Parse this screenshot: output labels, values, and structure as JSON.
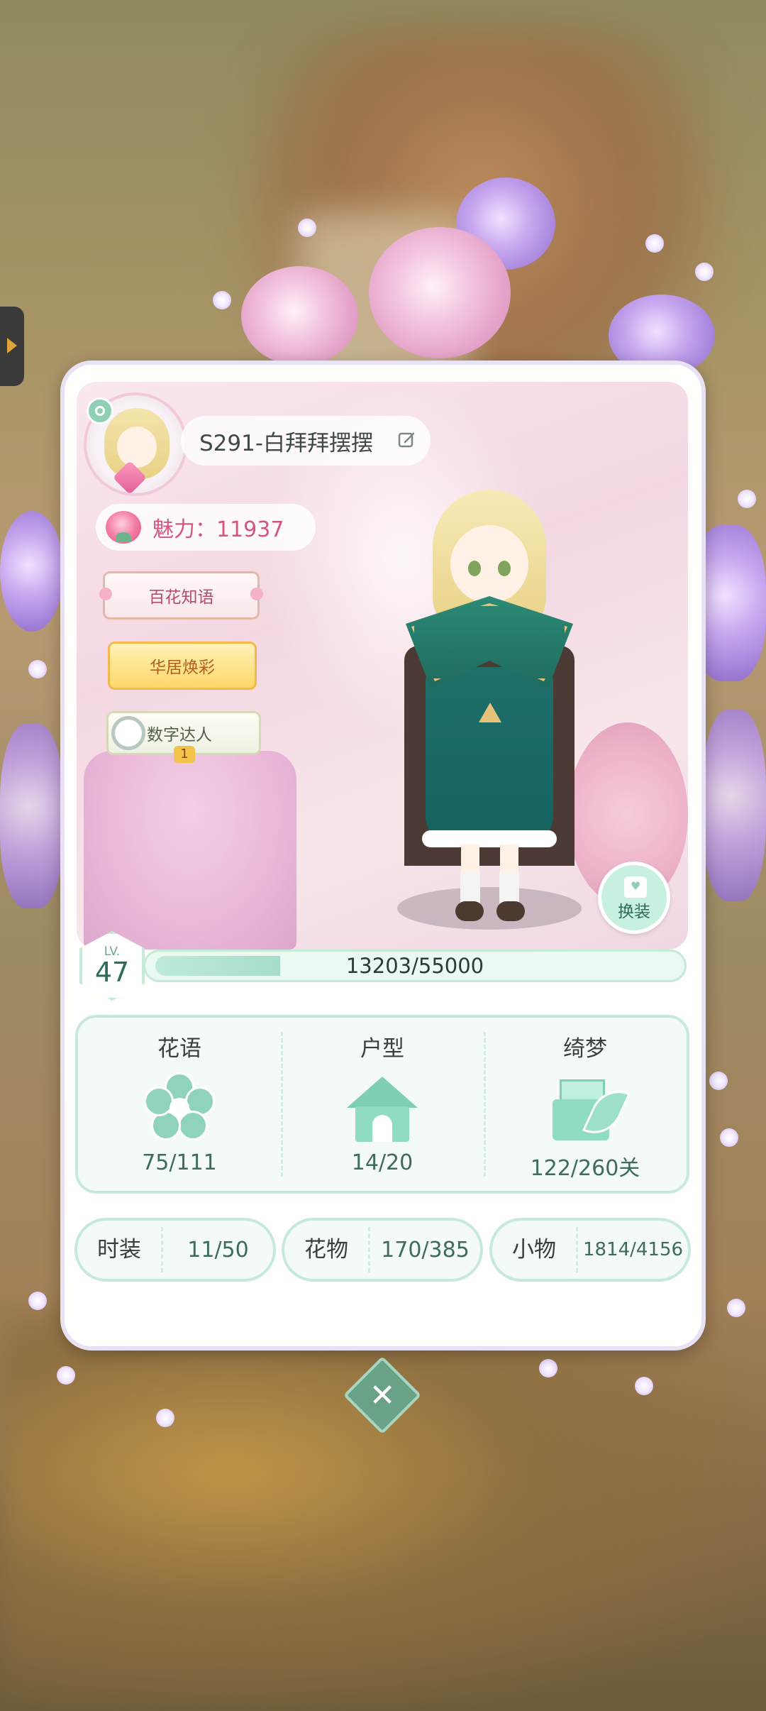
{
  "profile": {
    "name": "S291-白拜拜摆摆",
    "charm_label": "魅力：11937"
  },
  "badges": [
    "百花知语",
    "华居焕彩",
    "数字达人"
  ],
  "badge_number": "1",
  "swap_button": "换装",
  "level": {
    "lv_label": "LV.",
    "value": "47",
    "xp_text": "13203/55000",
    "xp_fraction": 0.24
  },
  "stats": [
    {
      "title": "花语",
      "value": "75/111",
      "icon": "flower-icon"
    },
    {
      "title": "户型",
      "value": "14/20",
      "icon": "house-icon"
    },
    {
      "title": "绮梦",
      "value": "122/260关",
      "icon": "letter-icon"
    }
  ],
  "collections": [
    {
      "label": "时装",
      "value": "11/50"
    },
    {
      "label": "花物",
      "value": "170/385"
    },
    {
      "label": "小物",
      "value": "1814/4156"
    }
  ],
  "close_label": "✕",
  "colors": {
    "accent": "#8fcfb4",
    "charm": "#d4557f",
    "text_dark": "#3a3f3c"
  }
}
